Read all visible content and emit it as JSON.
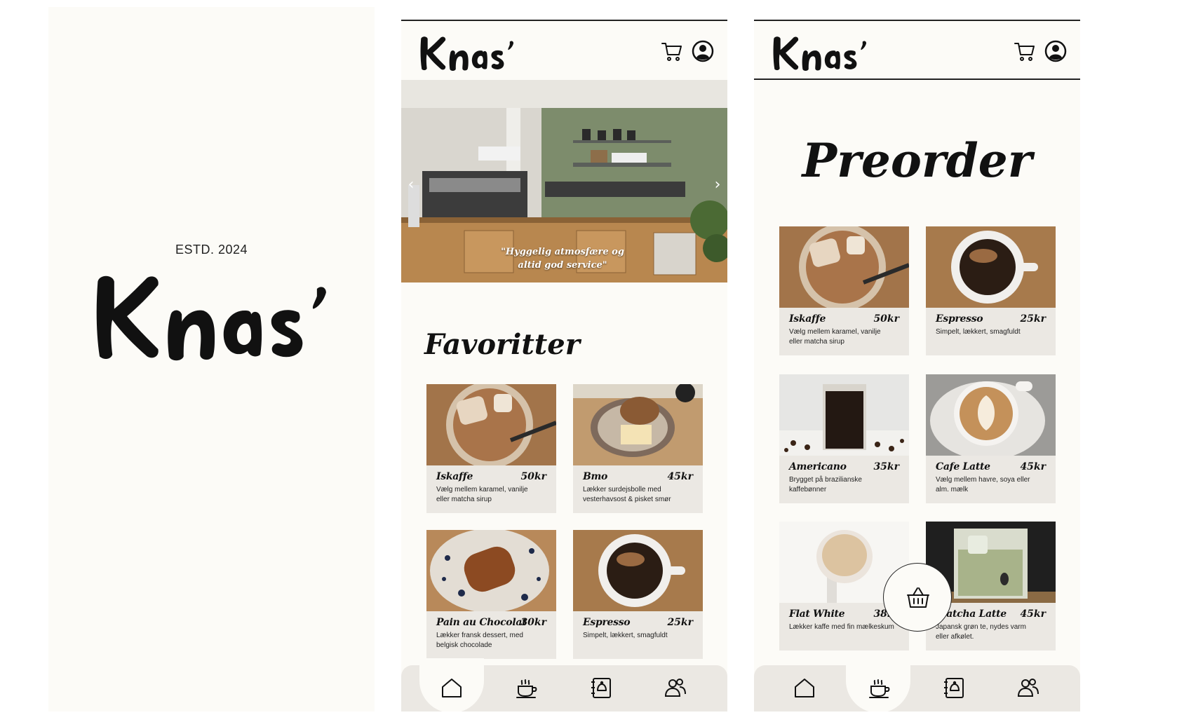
{
  "brand": {
    "logo_text": "Knas'",
    "estd": "ESTD. 2024"
  },
  "home": {
    "hero_quote": "\"Hyggelig atmosfære og altid god service\"",
    "section_title": "Favoritter",
    "cards": [
      {
        "name": "Iskaffe",
        "price": "50kr",
        "desc": "Vælg mellem karamel, vanilje eller matcha sirup",
        "image": "iced-coffee"
      },
      {
        "name": "Bmo",
        "price": "45kr",
        "desc": "Lækker surdejsbolle med vesterhavsost & pisket smør",
        "image": "bun-with-cheese"
      },
      {
        "name": "Pain au Chocolat",
        "price": "30kr",
        "desc": "Lækker fransk dessert, med belgisk chocolade",
        "image": "pain-au-chocolat"
      },
      {
        "name": "Espresso",
        "price": "25kr",
        "desc": "Simpelt, lækkert, smagfuldt",
        "image": "espresso-cup"
      }
    ]
  },
  "preorder": {
    "title": "Preorder",
    "cards": [
      {
        "name": "Iskaffe",
        "price": "50kr",
        "desc": "Vælg mellem karamel, vanilje eller matcha sirup",
        "image": "iced-coffee"
      },
      {
        "name": "Espresso",
        "price": "25kr",
        "desc": "Simpelt, lækkert, smagfuldt",
        "image": "espresso-cup"
      },
      {
        "name": "Americano",
        "price": "35kr",
        "desc": "Brygget på brazilianske kaffebønner",
        "image": "americano-glass"
      },
      {
        "name": "Cafe Latte",
        "price": "45kr",
        "desc": "Vælg mellem havre, soya eller alm. mælk",
        "image": "latte-art"
      },
      {
        "name": "Flat White",
        "price": "38kr",
        "desc": "Lækker kaffe med fin mælkeskum",
        "image": "flat-white"
      },
      {
        "name": "Matcha Latte",
        "price": "45kr",
        "desc": "Japansk grøn te, nydes varm eller afkølet.",
        "image": "matcha-latte"
      }
    ]
  },
  "icons": {
    "cart": "cart-icon",
    "profile": "profile-icon",
    "basket": "basket-icon",
    "nav": [
      "home-icon",
      "coffee-cup-icon",
      "menu-book-icon",
      "people-icon"
    ]
  },
  "colors": {
    "background": "#fcfbf7",
    "card": "#ebe8e3",
    "text": "#111111"
  }
}
